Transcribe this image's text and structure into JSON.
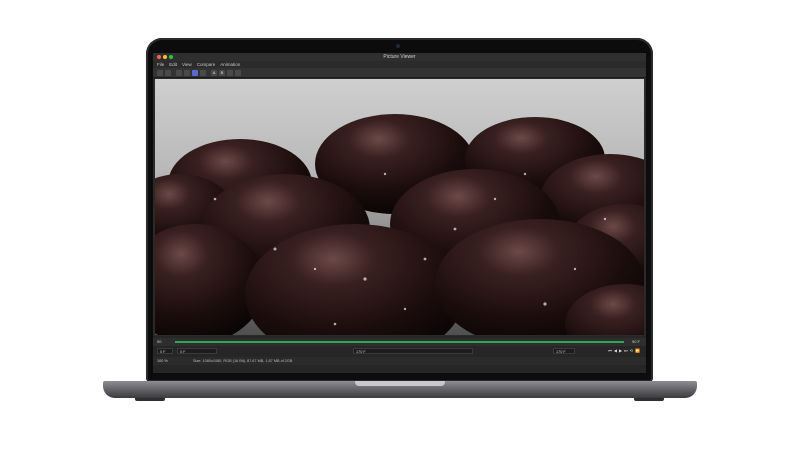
{
  "window": {
    "title": "Picture Viewer"
  },
  "menu": [
    "File",
    "Edit",
    "View",
    "Compare",
    "Animation"
  ],
  "toolbar": {
    "icons": [
      "folder-open-icon",
      "save-icon",
      "grid-icon",
      "crop-icon",
      "channels-icon",
      "contrast-icon",
      "a-icon",
      "b-icon",
      "compare-icon",
      "settings-icon"
    ]
  },
  "timeline": {
    "start_frame": "90",
    "end_frame": "90 F",
    "current_frame": "0 F",
    "mid_value": "0 F",
    "right_value": "170 F",
    "frame_field": "170 F"
  },
  "status": {
    "zoom": "100 %",
    "info": "Size: 1080x1080, RGB (16 Bit), 87.67 MB, 1.87 MB of 2GB"
  },
  "transport": [
    "⏮",
    "◀",
    "▶",
    "⏭",
    "⟲",
    "⏩"
  ],
  "colors": {
    "accent": "#2fa84f",
    "active_tool": "#5a6ad0"
  }
}
